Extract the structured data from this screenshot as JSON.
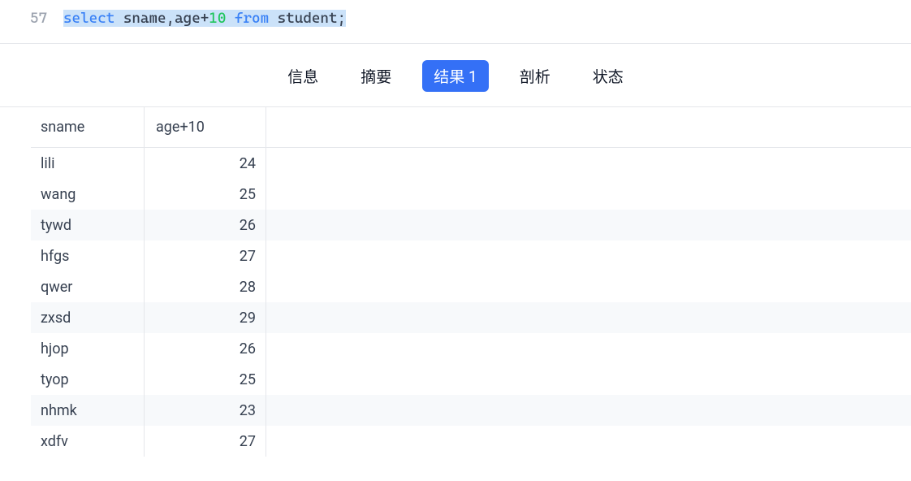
{
  "editor": {
    "line_number": "57",
    "select_kw": "select",
    "fields1": " sname,age+",
    "num10": "10",
    "from_kw": " from",
    "table": " student;"
  },
  "tabs": {
    "info": "信息",
    "summary": "摘要",
    "result": "结果 1",
    "profile": "剖析",
    "status": "状态"
  },
  "columns": {
    "sname": "sname",
    "age10": "age+10"
  },
  "rows": [
    {
      "sname": "lili",
      "age": "24",
      "alt": false
    },
    {
      "sname": "wang",
      "age": "25",
      "alt": false
    },
    {
      "sname": "tywd",
      "age": "26",
      "alt": true
    },
    {
      "sname": "hfgs",
      "age": "27",
      "alt": false
    },
    {
      "sname": "qwer",
      "age": "28",
      "alt": false
    },
    {
      "sname": "zxsd",
      "age": "29",
      "alt": true
    },
    {
      "sname": "hjop",
      "age": "26",
      "alt": false
    },
    {
      "sname": "tyop",
      "age": "25",
      "alt": false
    },
    {
      "sname": "nhmk",
      "age": "23",
      "alt": true
    },
    {
      "sname": "xdfv",
      "age": "27",
      "alt": false
    }
  ]
}
